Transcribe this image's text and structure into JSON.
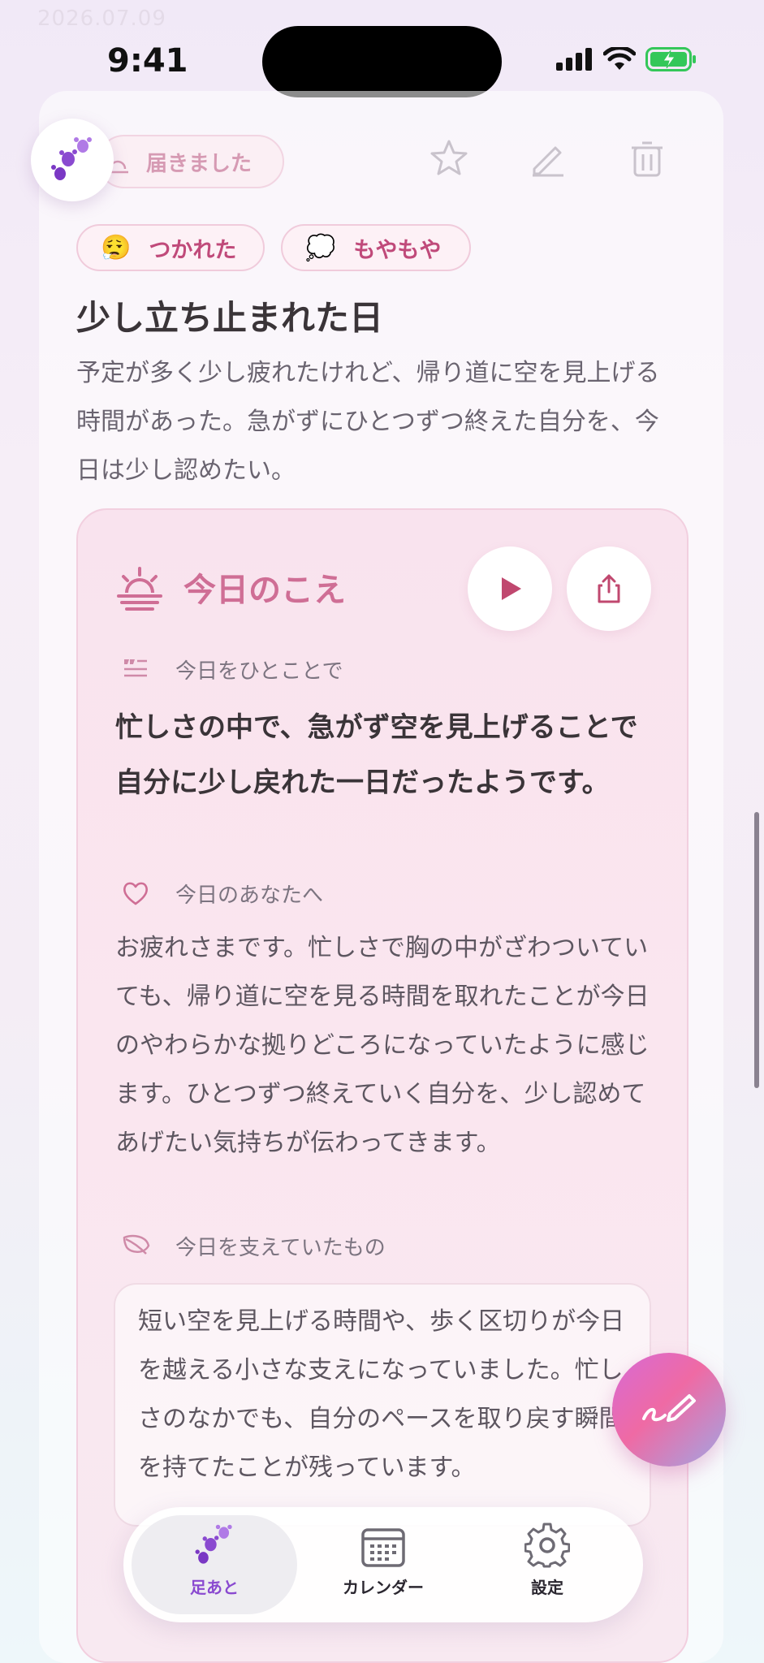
{
  "watermark_date": "2026.07.09",
  "status": {
    "time": "9:41"
  },
  "entry": {
    "delivered_label": "届きました",
    "moods": [
      {
        "emoji": "😮‍💨",
        "label": "つかれた"
      },
      {
        "emoji": "💭",
        "label": "もやもや"
      }
    ],
    "title": "少し立ち止まれた日",
    "body": "予定が多く少し疲れたけれど、帰り道に空を見上げる時間があった。急がずにひとつずつ終えた自分を、今日は少し認めたい。"
  },
  "voice": {
    "title": "今日のこえ",
    "sections": {
      "summary_label": "今日をひとことで",
      "summary": "忙しさの中で、急がず空を見上げることで自分に少し戻れた一日だったようです。",
      "message_label": "今日のあなたへ",
      "message": "お疲れさまです。忙しさで胸の中がざわついていても、帰り道に空を見る時間を取れたことが今日のやわらかな拠りどころになっていたように感じます。ひとつずつ終えていく自分を、少し認めてあげたい気持ちが伝わってきます。",
      "support_label": "今日を支えていたもの",
      "support": "短い空を見上げる時間や、歩く区切りが今日を越える小さな支えになっていました。忙しさのなかでも、自分のペースを取り戻す瞬間を持てたことが残っています。"
    }
  },
  "tabs": [
    {
      "label": "足あと",
      "icon": "footprints-icon",
      "active": true
    },
    {
      "label": "カレンダー",
      "icon": "calendar-icon",
      "active": false
    },
    {
      "label": "設定",
      "icon": "gear-icon",
      "active": false
    }
  ],
  "colors": {
    "accent_pink": "#cf6e95",
    "tab_active": "#8a4ad0",
    "logo_purple": "#8a4ad0"
  }
}
